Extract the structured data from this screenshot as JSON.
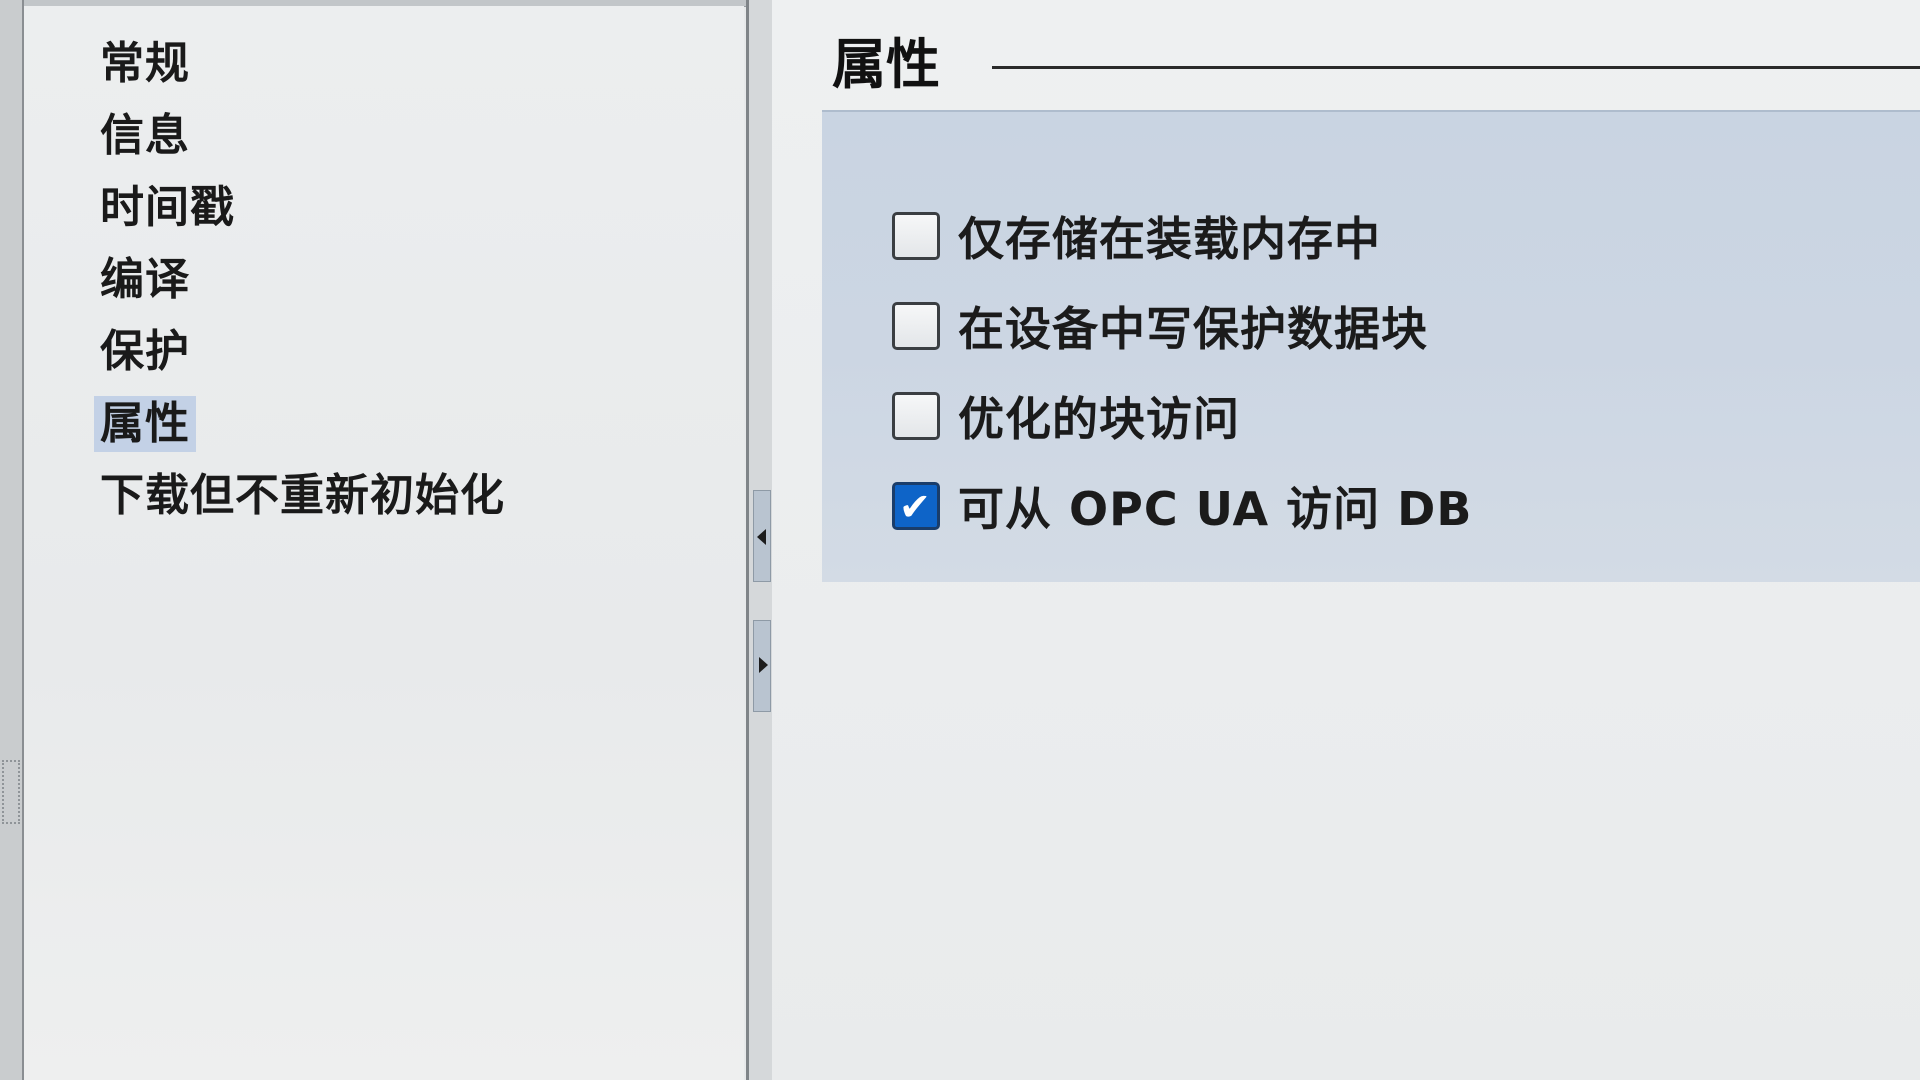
{
  "nav": {
    "items": [
      {
        "label": "常规",
        "selected": false
      },
      {
        "label": "信息",
        "selected": false
      },
      {
        "label": "时间戳",
        "selected": false
      },
      {
        "label": "编译",
        "selected": false
      },
      {
        "label": "保护",
        "selected": false
      },
      {
        "label": "属性",
        "selected": true
      },
      {
        "label": "下载但不重新初始化",
        "selected": false
      }
    ]
  },
  "splitter": {
    "collapse_icon": "triangle-left-icon",
    "expand_icon": "triangle-right-icon"
  },
  "content": {
    "section_title": "属性",
    "options": [
      {
        "label": "仅存储在装载内存中",
        "checked": false
      },
      {
        "label": "在设备中写保护数据块",
        "checked": false
      },
      {
        "label": "优化的块访问",
        "checked": false
      },
      {
        "label": "可从 OPC UA 访问 DB",
        "checked": true
      }
    ],
    "check_glyph": "✔"
  },
  "colors": {
    "selection_highlight": "#c3d1e6",
    "group_background": "#ccd6e3",
    "checkbox_checked": "#0e64c8"
  }
}
